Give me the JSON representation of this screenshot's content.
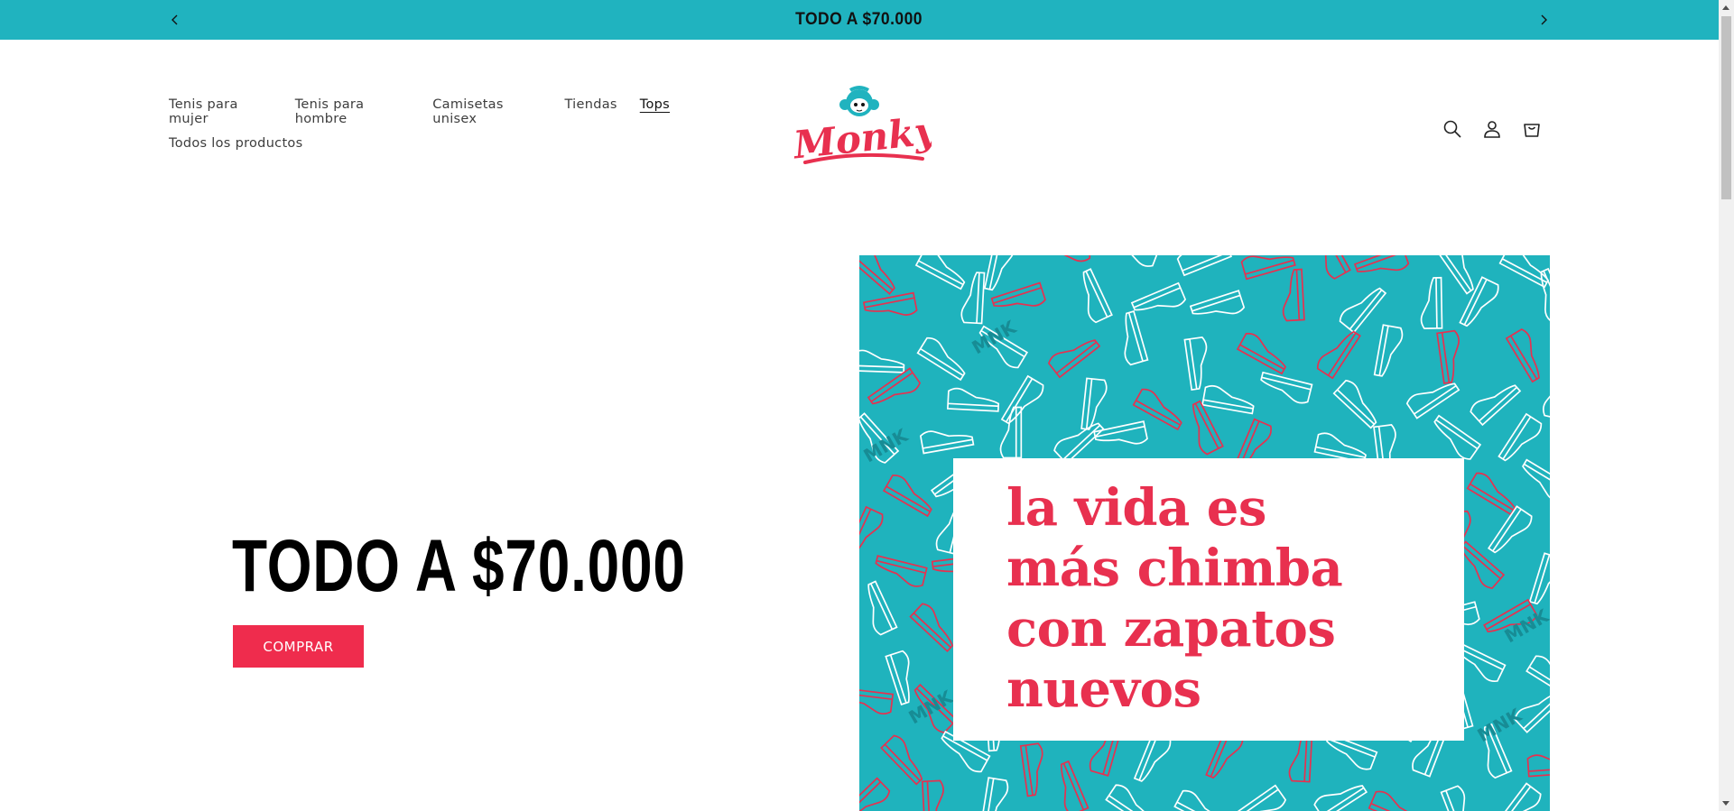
{
  "announcement": {
    "message": "TODO A $70.000",
    "prev_icon": "chevron-left-icon",
    "next_icon": "chevron-right-icon",
    "background": "#20b3bf"
  },
  "nav": {
    "items": [
      {
        "label": "Tenis para mujer"
      },
      {
        "label": "Tenis para hombre"
      },
      {
        "label": "Camisetas unisex"
      },
      {
        "label": "Tiendas"
      },
      {
        "label": "Tops",
        "active": true
      },
      {
        "label": "Todos los productos"
      }
    ]
  },
  "logo": {
    "text": "Monky",
    "icon": "monkey-head-icon",
    "colors": {
      "red": "#e8304f",
      "teal": "#20b3bf"
    }
  },
  "header_icons": [
    "search-icon",
    "account-icon",
    "cart-icon"
  ],
  "hero": {
    "title": "TODO A $70.000",
    "button_label": "COMPRAR",
    "button_color": "#ef2c4d"
  },
  "banner": {
    "lines": [
      "la vida es",
      "más chimba",
      "con zapatos",
      "nuevos"
    ],
    "pattern_text": "MNK",
    "background": "#1fb3bd",
    "accent": "#e8304f"
  }
}
